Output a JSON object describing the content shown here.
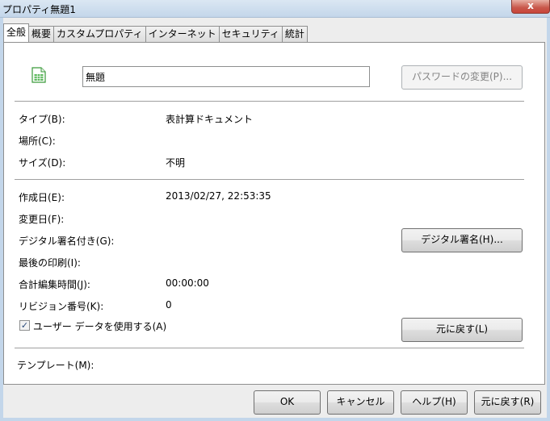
{
  "window": {
    "title": "プロパティ無題1",
    "close_label": "x"
  },
  "tabs": [
    {
      "label": "全般"
    },
    {
      "label": "概要"
    },
    {
      "label": "カスタムプロパティ"
    },
    {
      "label": "インターネット"
    },
    {
      "label": "セキュリティ"
    },
    {
      "label": "統計"
    }
  ],
  "general": {
    "icon": "spreadsheet-icon",
    "name_value": "無題",
    "password_button": "パスワードの変更(P)...",
    "type_label": "タイプ(B):",
    "type_value": "表計算ドキュメント",
    "location_label": "場所(C):",
    "size_label": "サイズ(D):",
    "size_value": "不明",
    "created_label": "作成日(E):",
    "created_value": "2013/02/27, 22:53:35",
    "modified_label": "変更日(F):",
    "signed_label": "デジタル署名付き(G):",
    "signature_button": "デジタル署名(H)...",
    "printed_label": "最後の印刷(I):",
    "editing_time_label": "合計編集時間(J):",
    "editing_time_value": "00:00:00",
    "revision_label": "リビジョン番号(K):",
    "revision_value": "0",
    "use_user_data_label": "ユーザー データを使用する(A)",
    "use_user_data_checked": true,
    "reset_button": "元に戻す(L)",
    "template_label": "テンプレート(M):"
  },
  "footer": {
    "ok": "OK",
    "cancel": "キャンセル",
    "help": "ヘルプ(H)",
    "reset": "元に戻す(R)"
  },
  "colors": {
    "titlebar": "#c3d6ea",
    "close": "#c9453a",
    "icon_green": "#3a9a3a"
  }
}
